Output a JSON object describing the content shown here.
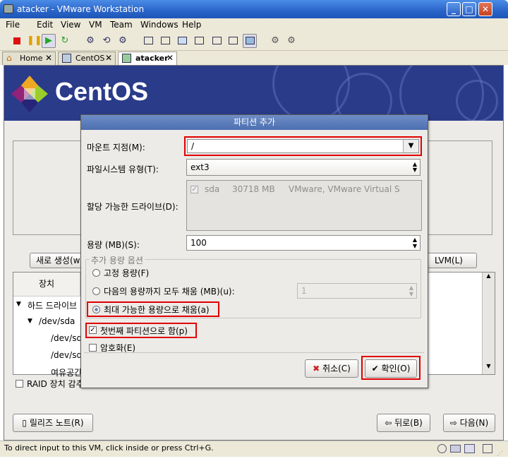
{
  "window": {
    "title": "atacker - VMware Workstation"
  },
  "menubar": {
    "items": [
      "File",
      "Edit",
      "View",
      "VM",
      "Team",
      "Windows",
      "Help"
    ]
  },
  "tabs": [
    {
      "label": "Home"
    },
    {
      "label": "CentOS"
    },
    {
      "label": "atacker"
    }
  ],
  "installer": {
    "brand": "CentOS",
    "new_button": "새로 생성(w",
    "lvm_button": "LVM(L)",
    "device_header": "장치",
    "tree": [
      "하드 드라이브",
      "/dev/sda",
      "/dev/sda",
      "/dev/sda",
      "여유공간"
    ],
    "raid_label": "RAID 장치 감추",
    "release_notes_button": "릴리즈 노트(R)",
    "back_button": "뒤로(B)",
    "next_button": "다음(N)"
  },
  "dialog": {
    "title": "파티션 추가",
    "mount_label": "마운트 지점(M):",
    "mount_value": "/",
    "fs_label": "파일시스템 유형(T):",
    "fs_value": "ext3",
    "drives_label": "할당 가능한 드라이브(D):",
    "drive_row": {
      "name": "sda",
      "size": "30718 MB",
      "model": "VMware, VMware Virtual S"
    },
    "size_label": "용량 (MB)(S):",
    "size_value": "100",
    "options_group": "추가 용량 옵션",
    "opt_fixed": "고정 용량(F)",
    "opt_upto": "다음의 용량까지 모두 채움 (MB)(u):",
    "opt_upto_value": "1",
    "opt_max": "최대 가능한 용량으로 채움(a)",
    "primary_label": "첫번째 파티션으로 함(p)",
    "encrypt_label": "암호화(E)",
    "cancel_button": "취소(C)",
    "ok_button": "확인(O)"
  },
  "statusbar": {
    "text": "To direct input to this VM, click inside or press Ctrl+G."
  },
  "colors": {
    "highlight": "#e00000",
    "titlebar": "#2a64c8",
    "banner": "#2a3b8a"
  }
}
